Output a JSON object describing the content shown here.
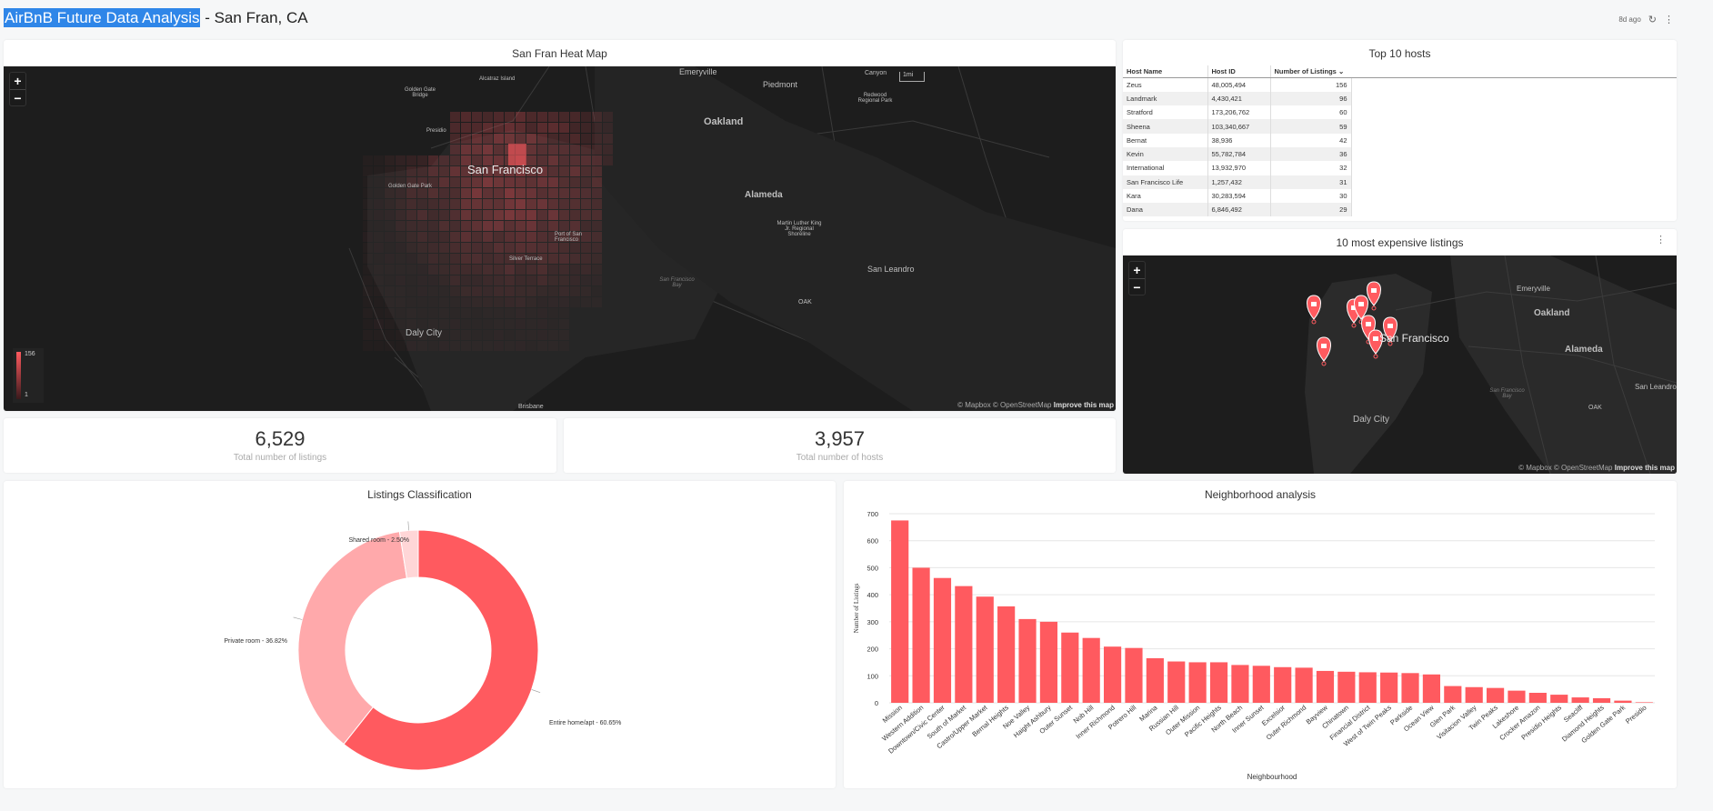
{
  "header": {
    "title_highlight": "AirBnB Future Data Analysis",
    "title_rest": " - San Fran, CA",
    "refreshed": "8d ago"
  },
  "heatmap": {
    "title": "San Fran Heat Map",
    "legend_max": "156",
    "legend_min": "1",
    "scale_label": "1mi",
    "attribution": "© Mapbox © OpenStreetMap",
    "improve": "Improve this map",
    "labels": {
      "sf": "San Francisco",
      "oakland": "Oakland",
      "alameda": "Alameda",
      "daly": "Daly City",
      "emeryville": "Emeryville",
      "piedmont": "Piedmont",
      "canyon": "Canyon",
      "redwood": "Redwood Regional Park",
      "alcatraz": "Alcatraz Island",
      "ggbridge": "Golden Gate Bridge",
      "presidio": "Presidio",
      "ggpark": "Golden Gate Park",
      "portsf": "Port of San Francisco",
      "silver": "Silver Terrace",
      "sfbay": "San Francisco Bay",
      "mlk": "Martin Luther King Jr. Regional Shoreline",
      "oak": "OAK",
      "leandro": "San Leandro",
      "brisbane": "Brisbane"
    }
  },
  "hosts": {
    "title": "Top 10 hosts",
    "columns": [
      "Host Name",
      "Host ID",
      "Number of Listings"
    ],
    "rows": [
      [
        "Zeus",
        "48,005,494",
        "156"
      ],
      [
        "Landmark",
        "4,430,421",
        "96"
      ],
      [
        "Stratford",
        "173,206,762",
        "60"
      ],
      [
        "Sheena",
        "103,340,667",
        "59"
      ],
      [
        "Bernat",
        "38,936",
        "42"
      ],
      [
        "Kevin",
        "55,782,784",
        "36"
      ],
      [
        "International",
        "13,932,970",
        "32"
      ],
      [
        "San Francisco Life",
        "1,257,432",
        "31"
      ],
      [
        "Kara",
        "30,283,594",
        "30"
      ],
      [
        "Dana",
        "6,846,492",
        "29"
      ]
    ]
  },
  "expensive": {
    "title": "10 most expensive listings",
    "attribution": "© Mapbox © OpenStreetMap",
    "improve": "Improve this map",
    "labels": {
      "sf": "San Francisco",
      "oakland": "Oakland",
      "alameda": "Alameda",
      "daly": "Daly City",
      "emeryville": "Emeryville",
      "sanleandro": "San Leandro",
      "oak": "OAK",
      "sfbay": "San Francisco Bay"
    }
  },
  "stats": {
    "listings_value": "6,529",
    "listings_label": "Total number of listings",
    "hosts_value": "3,957",
    "hosts_label": "Total number of hosts"
  },
  "colors": {
    "accent": "#ff5a5f",
    "accent_light": "#ffa9ab",
    "accent_lighter": "#ffd6d7",
    "map_bg": "#1d1d1d"
  },
  "chart_data": [
    {
      "type": "pie",
      "title": "Listings Classification",
      "slices": [
        {
          "label": "Entire home/apt - 60.65%",
          "value": 60.65,
          "color": "#ff5a5f"
        },
        {
          "label": "Private room - 36.82%",
          "value": 36.82,
          "color": "#ffa9ab"
        },
        {
          "label": "Shared room - 2.50%",
          "value": 2.5,
          "color": "#ffd6d7"
        }
      ]
    },
    {
      "type": "bar",
      "title": "Neighborhood analysis",
      "xlabel": "Neighbourhood",
      "ylabel": "Number of Listings",
      "ylim": [
        0,
        700
      ],
      "yticks": [
        0,
        100,
        200,
        300,
        400,
        500,
        600,
        700
      ],
      "categories": [
        "Mission",
        "Western Addition",
        "Downtown/Civic Center",
        "South of Market",
        "Castro/Upper Market",
        "Bernal Heights",
        "Noe Valley",
        "Haight Ashbury",
        "Outer Sunset",
        "Nob Hill",
        "Inner Richmond",
        "Potrero Hill",
        "Marina",
        "Russian Hill",
        "Outer Mission",
        "Pacific Heights",
        "North Beach",
        "Inner Sunset",
        "Excelsior",
        "Outer Richmond",
        "Bayview",
        "Chinatown",
        "Financial District",
        "West of Twin Peaks",
        "Parkside",
        "Ocean View",
        "Glen Park",
        "Visitacion Valley",
        "Twin Peaks",
        "Lakeshore",
        "Crocker Amazon",
        "Presidio Heights",
        "Seacliff",
        "Diamond Heights",
        "Golden Gate Park",
        "Presidio"
      ],
      "values": [
        675,
        500,
        462,
        432,
        393,
        357,
        310,
        300,
        260,
        240,
        208,
        203,
        165,
        153,
        150,
        150,
        140,
        137,
        132,
        130,
        118,
        115,
        113,
        112,
        110,
        105,
        62,
        58,
        55,
        45,
        37,
        30,
        20,
        17,
        8,
        2
      ]
    }
  ]
}
